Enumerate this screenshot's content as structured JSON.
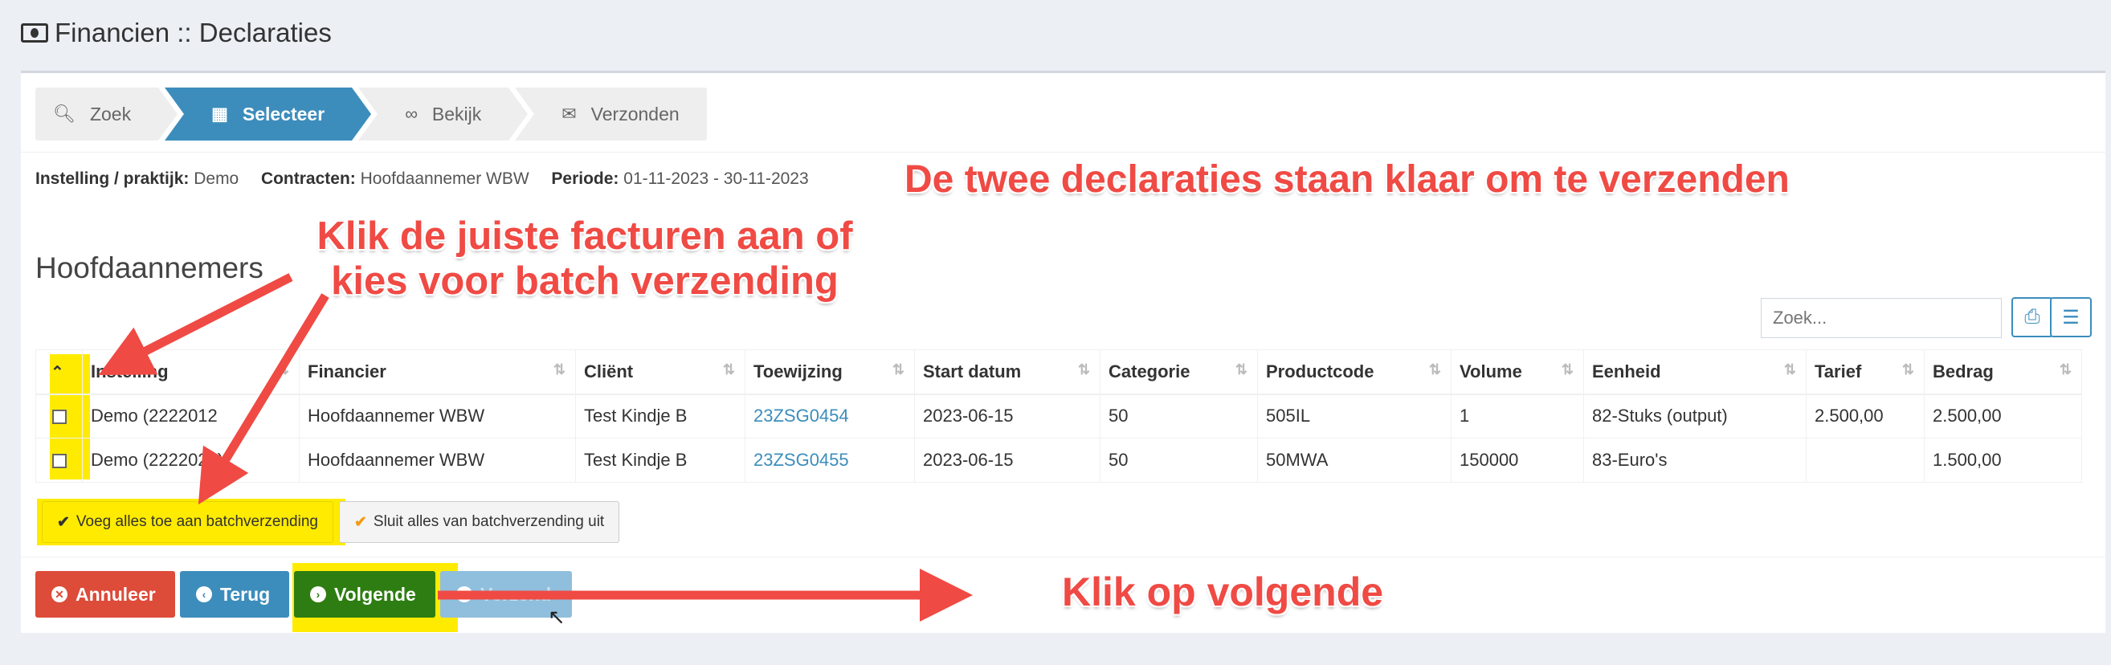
{
  "header": {
    "title": "Financien :: Declaraties"
  },
  "wizard": {
    "steps": [
      {
        "label": "Zoek",
        "icon": "search-icon"
      },
      {
        "label": "Selecteer",
        "icon": "table-icon"
      },
      {
        "label": "Bekijk",
        "icon": "link-icon"
      },
      {
        "label": "Verzonden",
        "icon": "envelope-icon"
      }
    ],
    "active_index": 1
  },
  "filters": {
    "instelling_label": "Instelling / praktijk:",
    "instelling_value": "Demo",
    "contracten_label": "Contracten:",
    "contracten_value": "Hoofdaannemer WBW",
    "periode_label": "Periode:",
    "periode_value": "01-11-2023 - 30-11-2023"
  },
  "section": {
    "title": "Hoofdaannemers"
  },
  "search": {
    "placeholder": "Zoek..."
  },
  "table": {
    "columns": [
      "Instelling",
      "Financier",
      "Cliënt",
      "Toewijzing",
      "Start datum",
      "Categorie",
      "Productcode",
      "Volume",
      "Eenheid",
      "Tarief",
      "Bedrag"
    ],
    "rows": [
      [
        "Demo (2222012",
        "Hoofdaannemer WBW",
        "Test Kindje B",
        "23ZSG0454",
        "2023-06-15",
        "50",
        "505IL",
        "1",
        "82-Stuks (output)",
        "2.500,00",
        "2.500,00"
      ],
      [
        "Demo (2222023)",
        "Hoofdaannemer WBW",
        "Test Kindje B",
        "23ZSG0455",
        "2023-06-15",
        "50",
        "50MWA",
        "150000",
        "83-Euro's",
        "",
        "1.500,00"
      ]
    ]
  },
  "batch": {
    "add_all": "Voeg alles toe aan batchverzending",
    "exclude_all": "Sluit alles van batchverzending uit"
  },
  "actions": {
    "cancel": "Annuleer",
    "back": "Terug",
    "next": "Volgende",
    "hidden": "Verzend"
  },
  "annotations": {
    "top_right": "De twee declaraties staan klaar om te verzenden",
    "left_line1": "Klik de juiste facturen aan of",
    "left_line2": "kies voor batch verzending",
    "bottom": "Klik op volgende"
  },
  "colors": {
    "primary": "#3c8dbc",
    "danger": "#dd4b39",
    "success": "#00a65a",
    "highlight": "#ffeb00",
    "annotation": "#f04a44"
  }
}
